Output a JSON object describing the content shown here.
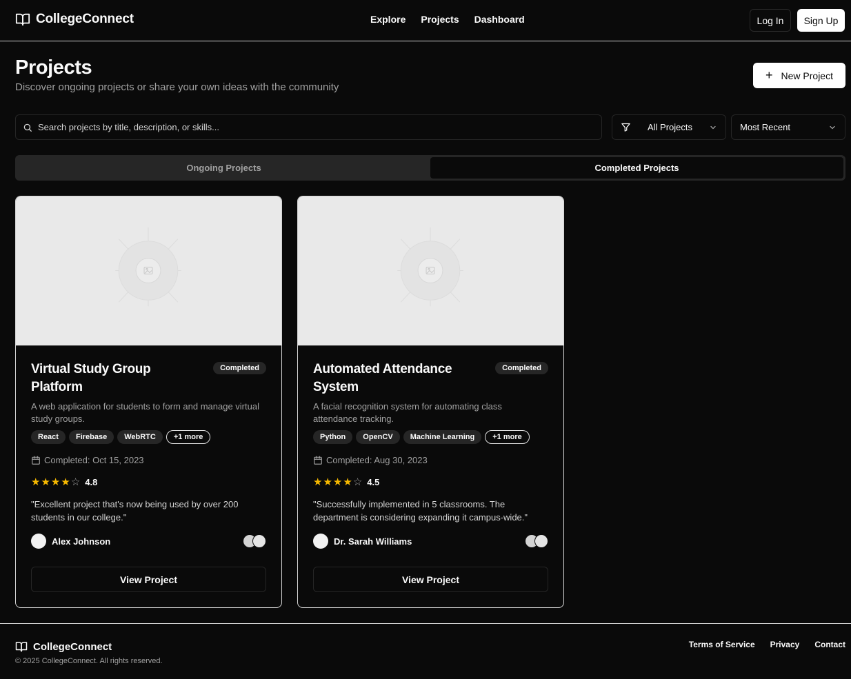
{
  "header": {
    "brand": "CollegeConnect",
    "nav": [
      "Explore",
      "Projects",
      "Dashboard"
    ],
    "login_label": "Log In",
    "signup_label": "Sign Up"
  },
  "page": {
    "title": "Projects",
    "subtitle": "Discover ongoing projects or share your own ideas with the community",
    "new_project_label": "New Project"
  },
  "filters": {
    "search_placeholder": "Search projects by title, description, or skills...",
    "category_selected": "All Projects",
    "sort_selected": "Most Recent"
  },
  "tabs": [
    {
      "label": "Ongoing Projects",
      "active": false
    },
    {
      "label": "Completed Projects",
      "active": true
    }
  ],
  "projects": [
    {
      "title": "Virtual Study Group Platform",
      "status": "Completed",
      "description": "A web application for students to form and manage virtual study groups.",
      "tags": [
        "React",
        "Firebase",
        "WebRTC"
      ],
      "more_tags": "+1 more",
      "completed": "Completed: Oct 15, 2023",
      "rating": 4.8,
      "rating_text": "4.8",
      "stars_filled": 4,
      "quote": "\"Excellent project that's now being used by over 200 students in our college.\"",
      "author": "Alex Johnson",
      "view_label": "View Project"
    },
    {
      "title": "Automated Attendance System",
      "status": "Completed",
      "description": "A facial recognition system for automating class attendance tracking.",
      "tags": [
        "Python",
        "OpenCV",
        "Machine Learning"
      ],
      "more_tags": "+1 more",
      "completed": "Completed: Aug 30, 2023",
      "rating": 4.5,
      "rating_text": "4.5",
      "stars_filled": 4,
      "quote": "\"Successfully implemented in 5 classrooms. The department is considering expanding it campus-wide.\"",
      "author": "Dr. Sarah Williams",
      "view_label": "View Project"
    }
  ],
  "footer": {
    "brand": "CollegeConnect",
    "copyright": "© 2025 CollegeConnect. All rights reserved.",
    "links": [
      "Terms of Service",
      "Privacy",
      "Contact"
    ]
  },
  "colors": {
    "background": "#0a0a0a",
    "star": "#f5b800",
    "muted": "#a1a1a1"
  }
}
